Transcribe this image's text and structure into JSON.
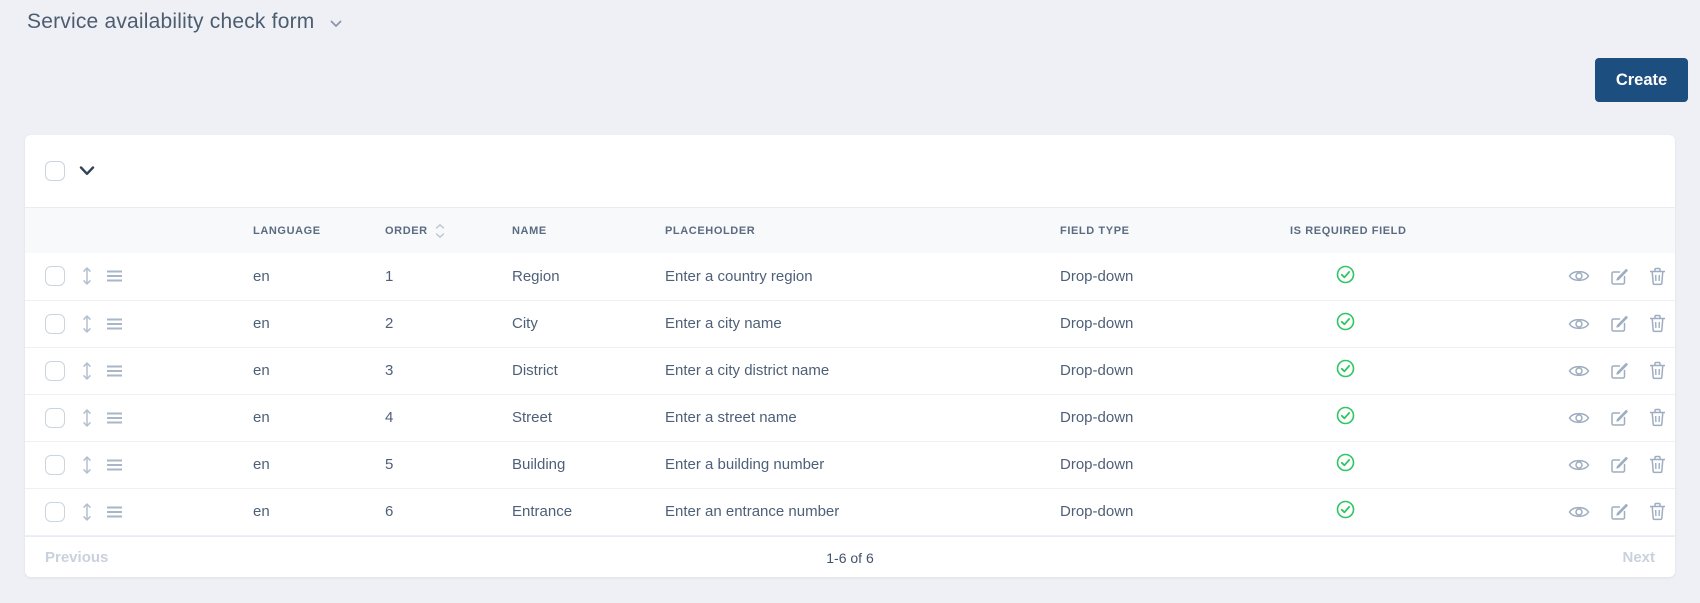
{
  "page": {
    "title": "Service availability check form"
  },
  "toolbar": {
    "create_label": "Create"
  },
  "table": {
    "columns": {
      "language": "LANGUAGE",
      "order": "ORDER",
      "name": "NAME",
      "placeholder": "PLACEHOLDER",
      "field_type": "FIELD TYPE",
      "is_required": "IS REQUIRED FIELD"
    },
    "rows": [
      {
        "language": "en",
        "order": "1",
        "name": "Region",
        "placeholder": "Enter a country region",
        "field_type": "Drop-down",
        "is_required": true
      },
      {
        "language": "en",
        "order": "2",
        "name": "City",
        "placeholder": "Enter a city name",
        "field_type": "Drop-down",
        "is_required": true
      },
      {
        "language": "en",
        "order": "3",
        "name": "District",
        "placeholder": "Enter a city district name",
        "field_type": "Drop-down",
        "is_required": true
      },
      {
        "language": "en",
        "order": "4",
        "name": "Street",
        "placeholder": "Enter a street name",
        "field_type": "Drop-down",
        "is_required": true
      },
      {
        "language": "en",
        "order": "5",
        "name": "Building",
        "placeholder": "Enter a building number",
        "field_type": "Drop-down",
        "is_required": true
      },
      {
        "language": "en",
        "order": "6",
        "name": "Entrance",
        "placeholder": "Enter an entrance number",
        "field_type": "Drop-down",
        "is_required": true
      }
    ]
  },
  "pagination": {
    "previous_label": "Previous",
    "range_label": "1-6 of 6",
    "next_label": "Next"
  },
  "icons": {
    "title-dropdown-chevron": "v-chevron",
    "select-all-chevron": "v-chevron",
    "move-icon": "up-down-arrow",
    "drag-handle-icon": "three-lines",
    "sort-icon": "up-down-chevrons",
    "required-check-icon": "check-in-circle",
    "view-icon": "eye",
    "edit-icon": "pencil-in-square",
    "delete-icon": "trash-can"
  },
  "colors": {
    "accent": "#1c4e80",
    "success": "#2fc662",
    "page_background": "#eef0f5"
  }
}
